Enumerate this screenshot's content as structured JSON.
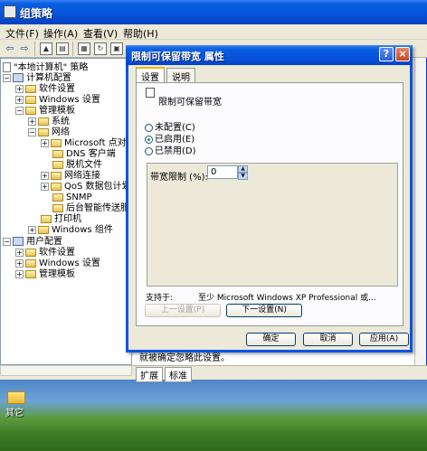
{
  "main_window": {
    "title": "组策略"
  },
  "menu": {
    "items": [
      "文件(F)",
      "操作(A)",
      "查看(V)",
      "帮助(H)"
    ]
  },
  "toolbar": {
    "icons": [
      "back-icon",
      "forward-icon",
      "up-folder-icon",
      "show-tree-icon",
      "properties-icon",
      "refresh-icon",
      "export-icon"
    ]
  },
  "tree": {
    "root": "\"本地计算机\" 策略",
    "nodes": [
      {
        "label": "计算机配置",
        "icon": "computer-icon"
      },
      {
        "label": "软件设置",
        "icon": "folder-icon"
      },
      {
        "label": "Windows 设置",
        "icon": "folder-icon"
      },
      {
        "label": "管理模板",
        "icon": "folder-icon"
      },
      {
        "label": "系统",
        "icon": "folder-icon"
      },
      {
        "label": "网络",
        "icon": "folder-icon"
      },
      {
        "label": "Microsoft 点对点",
        "icon": "folder-icon"
      },
      {
        "label": "DNS 客户端",
        "icon": "folder-icon"
      },
      {
        "label": "脱机文件",
        "icon": "folder-icon"
      },
      {
        "label": "网络连接",
        "icon": "folder-icon"
      },
      {
        "label": "QoS 数据包计划程",
        "icon": "folder-icon"
      },
      {
        "label": "SNMP",
        "icon": "folder-icon"
      },
      {
        "label": "后台智能传送服务",
        "icon": "folder-icon"
      },
      {
        "label": "打印机",
        "icon": "folder-icon"
      },
      {
        "label": "Windows 组件",
        "icon": "folder-icon"
      },
      {
        "label": "用户配置",
        "icon": "computer-icon"
      },
      {
        "label": "软件设置",
        "icon": "folder-icon"
      },
      {
        "label": "Windows 设置",
        "icon": "folder-icon"
      },
      {
        "label": "管理模板",
        "icon": "folder-icon"
      }
    ]
  },
  "right_pane": {
    "description_fragment": "就被确定忽略此设置。"
  },
  "view_tabs": {
    "extended": "扩展",
    "standard": "标准"
  },
  "dialog": {
    "title": "限制可保留带宽 属性",
    "help_glyph": "?",
    "close_glyph": "×",
    "tabs": {
      "settings": "设置",
      "explain": "说明"
    },
    "policy_name": "限制可保留带宽",
    "radio": {
      "not_configured": "未配置(C)",
      "enabled": "已启用(E)",
      "disabled": "已禁用(D)"
    },
    "selected": "enabled",
    "bandwidth_label": "带宽限制 (%):",
    "bandwidth_value": "0",
    "supported_label": "支持于:",
    "supported_value": "至少 Microsoft Windows XP Professional 或...",
    "buttons": {
      "prev": "上一设置(P)",
      "next": "下一设置(N)",
      "ok": "确定",
      "cancel": "取消",
      "apply": "应用(A)"
    }
  },
  "desktop": {
    "icon_label": "其它"
  }
}
